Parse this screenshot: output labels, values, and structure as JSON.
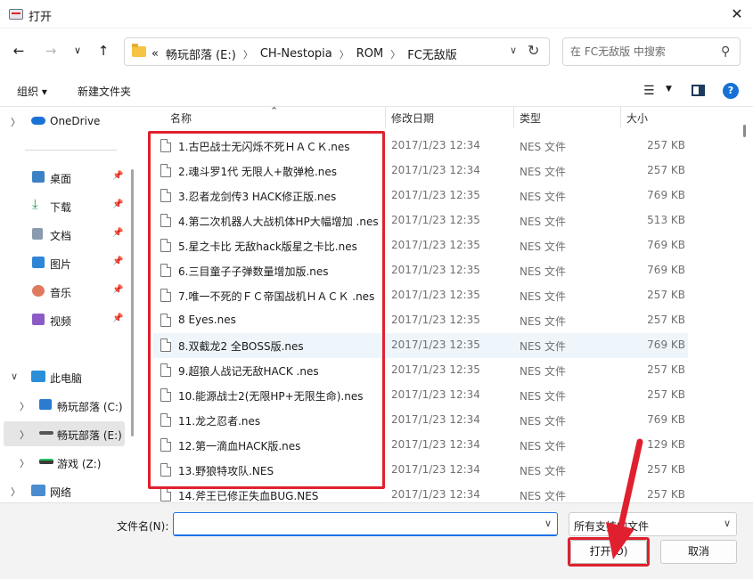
{
  "window": {
    "title": "打开"
  },
  "nav": {
    "breadcrumbs": [
      "«",
      "畅玩部落 (E:)",
      "CH-Nestopia",
      "ROM",
      "FC无敌版"
    ],
    "search_placeholder": "在 FC无敌版 中搜索"
  },
  "toolbar": {
    "organize": "组织 ▾",
    "new_folder": "新建文件夹"
  },
  "sidebar": {
    "items": [
      {
        "label": "OneDrive",
        "icon": "cloud-icon",
        "expandable": true
      },
      {
        "label": "桌面",
        "icon": "desktop-icon",
        "pinned": true
      },
      {
        "label": "下载",
        "icon": "download-icon",
        "pinned": true
      },
      {
        "label": "文档",
        "icon": "document-icon",
        "pinned": true
      },
      {
        "label": "图片",
        "icon": "picture-icon",
        "pinned": true
      },
      {
        "label": "音乐",
        "icon": "music-icon",
        "pinned": true
      },
      {
        "label": "视频",
        "icon": "video-icon",
        "pinned": true
      },
      {
        "label": "此电脑",
        "icon": "computer-icon",
        "expandable": true,
        "expanded": true
      },
      {
        "label": "畅玩部落 (C:)",
        "icon": "windows-drive-icon",
        "expandable": true
      },
      {
        "label": "畅玩部落 (E:)",
        "icon": "drive-icon",
        "expandable": true,
        "active": true
      },
      {
        "label": "游戏 (Z:)",
        "icon": "drive-green-icon",
        "expandable": true
      },
      {
        "label": "网络",
        "icon": "network-icon",
        "expandable": true
      }
    ]
  },
  "columns": {
    "name": "名称",
    "date": "修改日期",
    "type": "类型",
    "size": "大小"
  },
  "files": [
    {
      "name": "1.古巴战士无闪烁不死ＨＡＣＫ.nes",
      "date": "2017/1/23 12:34",
      "type": "NES 文件",
      "size": "257 KB"
    },
    {
      "name": "2.魂斗罗1代 无限人+散弹枪.nes",
      "date": "2017/1/23 12:34",
      "type": "NES 文件",
      "size": "257 KB"
    },
    {
      "name": "3.忍者龙剑传3 HACK修正版.nes",
      "date": "2017/1/23 12:35",
      "type": "NES 文件",
      "size": "769 KB"
    },
    {
      "name": "4.第二次机器人大战机体HP大幅增加 .nes",
      "date": "2017/1/23 12:35",
      "type": "NES 文件",
      "size": "513 KB"
    },
    {
      "name": "5.星之卡比 无敌hack版星之卡比.nes",
      "date": "2017/1/23 12:35",
      "type": "NES 文件",
      "size": "769 KB"
    },
    {
      "name": "6.三目童子子弹数量增加版.nes",
      "date": "2017/1/23 12:35",
      "type": "NES 文件",
      "size": "769 KB"
    },
    {
      "name": "7.唯一不死的ＦＣ帝国战机ＨＡＣＫ .nes",
      "date": "2017/1/23 12:35",
      "type": "NES 文件",
      "size": "257 KB"
    },
    {
      "name": "8 Eyes.nes",
      "date": "2017/1/23 12:35",
      "type": "NES 文件",
      "size": "257 KB"
    },
    {
      "name": "8.双截龙2 全BOSS版.nes",
      "date": "2017/1/23 12:35",
      "type": "NES 文件",
      "size": "769 KB"
    },
    {
      "name": "9.超狼人战记无敌HACK .nes",
      "date": "2017/1/23 12:35",
      "type": "NES 文件",
      "size": "257 KB"
    },
    {
      "name": "10.能源战士2(无限HP+无限生命).nes",
      "date": "2017/1/23 12:34",
      "type": "NES 文件",
      "size": "257 KB"
    },
    {
      "name": "11.龙之忍者.nes",
      "date": "2017/1/23 12:34",
      "type": "NES 文件",
      "size": "769 KB"
    },
    {
      "name": "12.第一滴血HACK版.nes",
      "date": "2017/1/23 12:34",
      "type": "NES 文件",
      "size": "129 KB"
    },
    {
      "name": "13.野狼特攻队.NES",
      "date": "2017/1/23 12:34",
      "type": "NES 文件",
      "size": "257 KB"
    },
    {
      "name": "14.斧王已修正失血BUG.NES",
      "date": "2017/1/23 12:34",
      "type": "NES 文件",
      "size": "257 KB"
    }
  ],
  "footer": {
    "filename_label": "文件名(N):",
    "filename_value": "",
    "filter_value": "所有支持的文件",
    "open_label": "打开(O)",
    "cancel_label": "取消"
  },
  "colors": {
    "highlight": "#e0202e",
    "accent": "#1a73e8",
    "selected_row": "#eef6fc"
  }
}
